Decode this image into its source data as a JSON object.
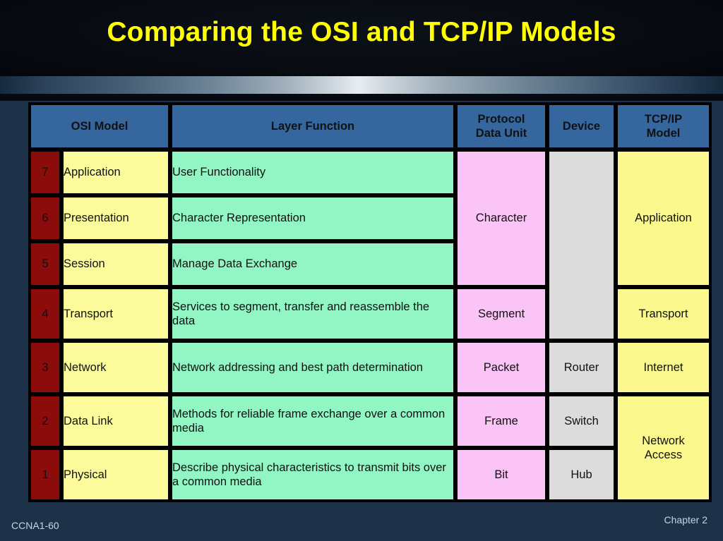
{
  "slide": {
    "title": "Comparing the OSI and TCP/IP Models",
    "footer_left": "CCNA1-60",
    "footer_right": "Chapter 2",
    "colors": {
      "title_text": "#ffff00",
      "background": "#1d3148",
      "header_fill": "#35679e",
      "header_text": "#ffff00",
      "layer_number_fill": "#8c0c0c",
      "layer_number_text": "#ffd21e",
      "layer_name_fill": "#fcfb9c",
      "layer_function_fill": "#92f5c4",
      "pdu_fill": "#fbc4f7",
      "device_fill": "#dcdcdc",
      "tcpip_fill": "#fbf88e",
      "grid_line": "#000000"
    }
  },
  "table": {
    "headers": {
      "osi_model": "OSI Model",
      "layer_function": "Layer Function",
      "protocol_data_unit_line1": "Protocol",
      "protocol_data_unit_line2": "Data Unit",
      "device": "Device",
      "tcpip_model_line1": "TCP/IP",
      "tcpip_model_line2": "Model"
    },
    "rows": [
      {
        "number": "7",
        "layer": "Application",
        "function": "User Functionality"
      },
      {
        "number": "6",
        "layer": "Presentation",
        "function": "Character Representation"
      },
      {
        "number": "5",
        "layer": "Session",
        "function": "Manage Data Exchange"
      },
      {
        "number": "4",
        "layer": "Transport",
        "function": "Services to segment, transfer and reassemble the data"
      },
      {
        "number": "3",
        "layer": "Network",
        "function": "Network addressing and best path determination"
      },
      {
        "number": "2",
        "layer": "Data Link",
        "function": "Methods for reliable frame exchange over a common media"
      },
      {
        "number": "1",
        "layer": "Physical",
        "function": "Describe physical characteristics to transmit bits over a common media"
      }
    ],
    "pdu": {
      "character": "Character",
      "segment": "Segment",
      "packet": "Packet",
      "frame": "Frame",
      "bit": "Bit"
    },
    "device": {
      "upper_blank": "",
      "router": "Router",
      "switch": "Switch",
      "hub": "Hub"
    },
    "tcpip": {
      "application": "Application",
      "transport": "Transport",
      "internet": "Internet",
      "network_access_line1": "Network",
      "network_access_line2": "Access"
    }
  }
}
